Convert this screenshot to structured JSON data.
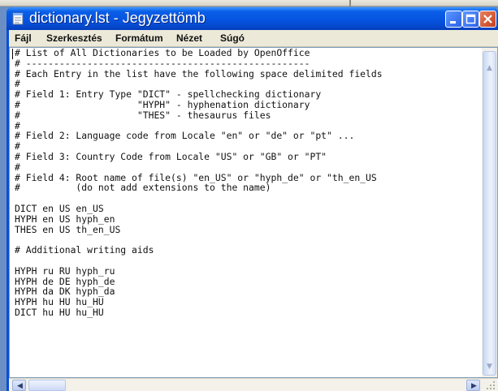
{
  "window": {
    "title": "dictionary.lst - Jegyzettömb",
    "icon": "notepad-icon",
    "colors": {
      "titlebar": "#0554e0",
      "close": "#c4401c",
      "menubar": "#ece9d8"
    }
  },
  "menu": {
    "items": [
      {
        "label": "Fájl"
      },
      {
        "label": "Szerkesztés"
      },
      {
        "label": "Formátum"
      },
      {
        "label": "Nézet"
      },
      {
        "label": "Súgó"
      }
    ]
  },
  "document": {
    "lines": [
      "# List of All Dictionaries to be Loaded by OpenOffice",
      "# ---------------------------------------------------",
      "# Each Entry in the list have the following space delimited fields",
      "#",
      "# Field 1: Entry Type \"DICT\" - spellchecking dictionary",
      "#                     \"HYPH\" - hyphenation dictionary",
      "#                     \"THES\" - thesaurus files",
      "#",
      "# Field 2: Language code from Locale \"en\" or \"de\" or \"pt\" ...",
      "#",
      "# Field 3: Country Code from Locale \"US\" or \"GB\" or \"PT\"",
      "#",
      "# Field 4: Root name of file(s) \"en_US\" or \"hyph_de\" or \"th_en_US",
      "#          (do not add extensions to the name)",
      "",
      "DICT en US en_US",
      "HYPH en US hyph_en",
      "THES en US th_en_US",
      "",
      "# Additional writing aids",
      "",
      "HYPH ru RU hyph_ru",
      "HYPH de DE hyph_de",
      "HYPH da DK hyph_da",
      "HYPH hu HU hu_HU",
      "DICT hu HU hu_HU"
    ]
  }
}
